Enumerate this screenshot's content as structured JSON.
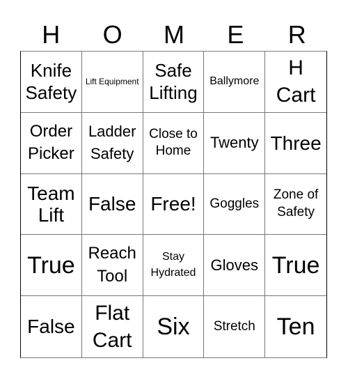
{
  "header": [
    "H",
    "O",
    "M",
    "E",
    "R"
  ],
  "cells": [
    "Knife Safety",
    "Lift Equipment",
    "Safe Lifting",
    "Ballymore",
    "H Cart",
    "Order Picker",
    "Ladder Safety",
    "Close to Home",
    "Twenty",
    "Three",
    "Team Lift",
    "False",
    "Free!",
    "Goggles",
    "Zone of Safety",
    "True",
    "Reach Tool",
    "Stay Hydrated",
    "Gloves",
    "True",
    "False",
    "Flat Cart",
    "Six",
    "Stretch",
    "Ten"
  ]
}
